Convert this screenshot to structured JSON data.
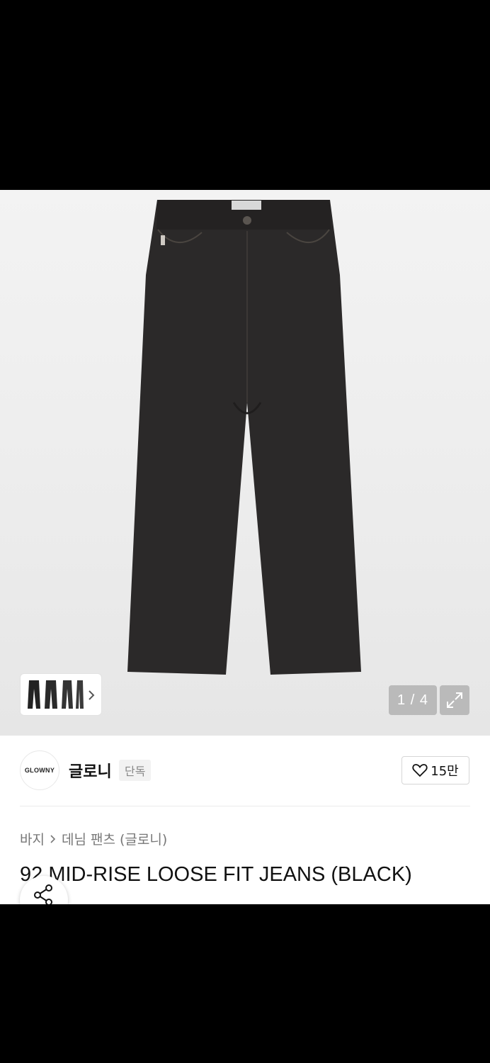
{
  "gallery": {
    "counter": "1 / 4",
    "expand_icon": "expand-icon",
    "thumbnail_chevron_icon": "chevron-right-icon"
  },
  "brand": {
    "logo_text": "GLOWNY",
    "name": "글로니",
    "badge": "단독"
  },
  "like": {
    "icon": "heart-icon",
    "count": "15만"
  },
  "breadcrumb": {
    "items": [
      "바지",
      "데님 팬츠 (글로니)"
    ],
    "separator_icon": "chevron-right-icon"
  },
  "product": {
    "title": "92 MID-RISE LOOSE FIT JEANS (BLACK)"
  },
  "share": {
    "icon": "share-icon"
  },
  "colors": {
    "jeans": "#2a2828",
    "background": "#f0f0f0"
  }
}
